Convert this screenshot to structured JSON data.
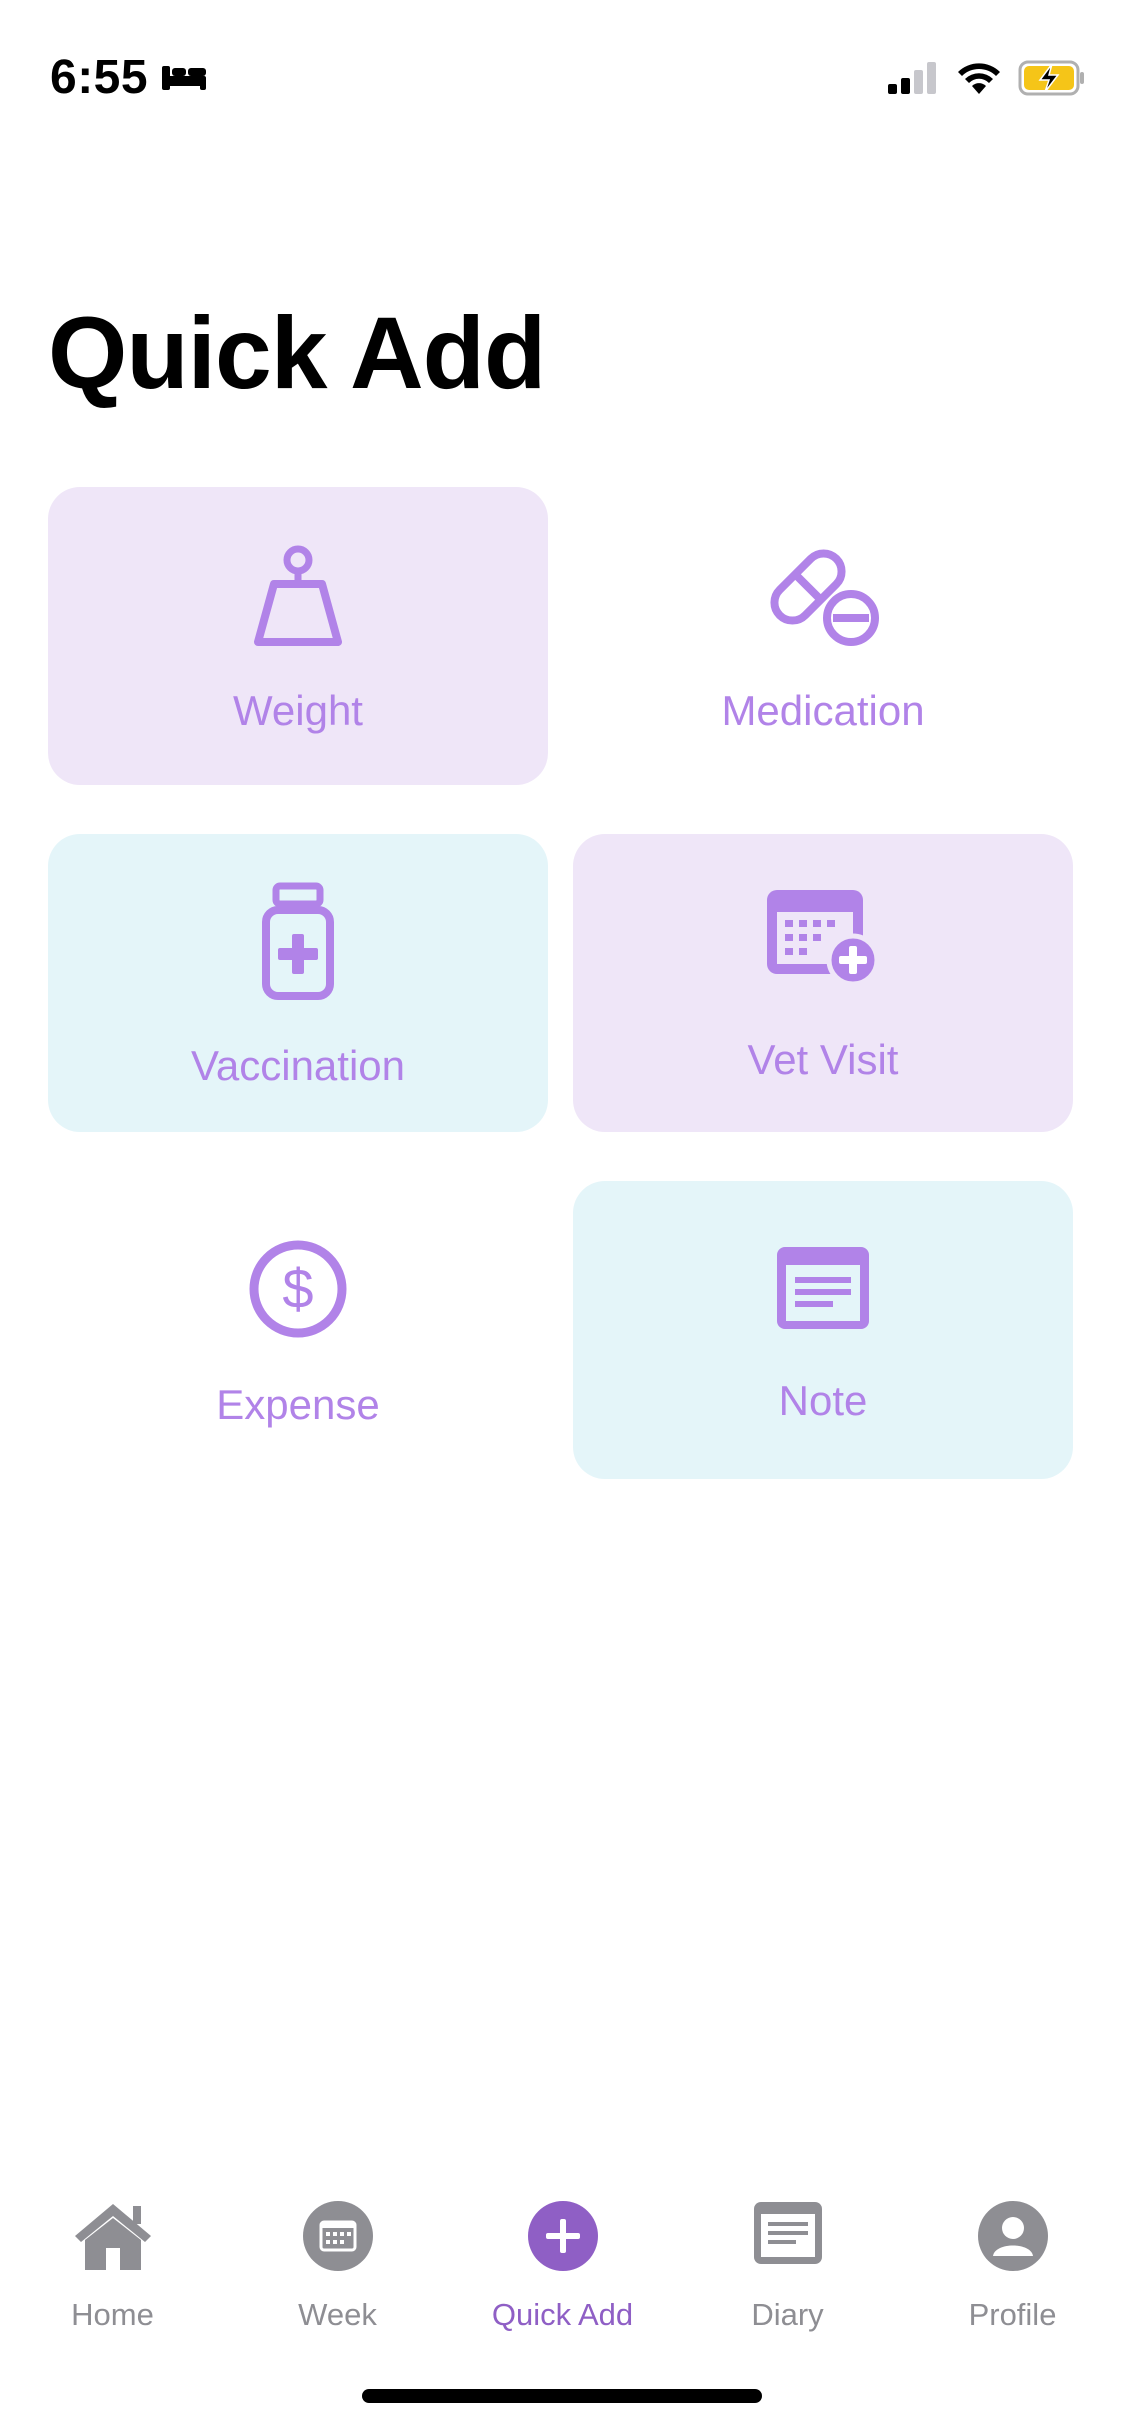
{
  "status_bar": {
    "time": "6:55",
    "sleep_icon": "bed-icon",
    "signal_icon": "cellular-signal-icon",
    "wifi_icon": "wifi-icon",
    "battery_icon": "battery-charging-icon",
    "battery_color": "#f5c518"
  },
  "page": {
    "title": "Quick Add"
  },
  "tiles": [
    {
      "label": "Weight",
      "icon": "weight-icon",
      "background": "#efe6f8"
    },
    {
      "label": "Medication",
      "icon": "pills-icon",
      "background": "transparent"
    },
    {
      "label": "Vaccination",
      "icon": "vaccine-bottle-icon",
      "background": "#e4f5f9"
    },
    {
      "label": "Vet Visit",
      "icon": "calendar-add-icon",
      "background": "#efe6f8"
    },
    {
      "label": "Expense",
      "icon": "dollar-icon",
      "background": "transparent"
    },
    {
      "label": "Note",
      "icon": "note-icon",
      "background": "#e4f5f9"
    }
  ],
  "tab_bar": {
    "items": [
      {
        "label": "Home",
        "icon": "home-icon",
        "active": false
      },
      {
        "label": "Week",
        "icon": "calendar-icon",
        "active": false
      },
      {
        "label": "Quick Add",
        "icon": "plus-icon",
        "active": true
      },
      {
        "label": "Diary",
        "icon": "diary-icon",
        "active": false
      },
      {
        "label": "Profile",
        "icon": "profile-icon",
        "active": false
      }
    ]
  },
  "colors": {
    "accent": "#b183e8",
    "tab_active": "#8f5fc5",
    "tab_inactive": "#8e8e93"
  }
}
